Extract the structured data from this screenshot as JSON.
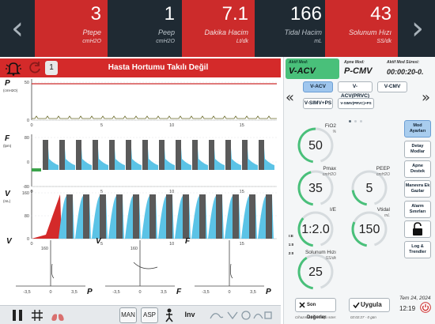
{
  "metrics": [
    {
      "value": "3",
      "label": "Ptepe",
      "unit": "cmH2O",
      "style": "red"
    },
    {
      "value": "1",
      "label": "Peep",
      "unit": "cmH2O",
      "style": "dark"
    },
    {
      "value": "7.1",
      "label": "Dakika Hacim",
      "unit": "Lt/dk",
      "style": "red"
    },
    {
      "value": "166",
      "label": "Tidal Hacim",
      "unit": "mL",
      "style": "dark"
    },
    {
      "value": "43",
      "label": "Solunum Hızı",
      "unit": "SS/dk",
      "style": "red"
    }
  ],
  "alarm": {
    "count": "1",
    "message": "Hasta Hortumu Takılı Değil"
  },
  "waves": [
    {
      "label": "P",
      "unit": "(cmH2O)",
      "yticks": [
        "50",
        "0"
      ],
      "xticks": [
        "0",
        "5",
        "10",
        "15"
      ]
    },
    {
      "label": "F",
      "unit": "(lpm)",
      "yticks": [
        "80",
        "0",
        "-80"
      ],
      "xticks": [
        "0",
        "5",
        "10",
        "15"
      ]
    },
    {
      "label": "V",
      "unit": "(mL)",
      "yticks": [
        "160",
        "80",
        "0"
      ],
      "xticks": [
        "0",
        "5",
        "10",
        "15"
      ]
    }
  ],
  "loops": [
    {
      "ylabel": "V",
      "xlabel": "P",
      "ytick": "160",
      "xticks": [
        "-3,5",
        "0",
        "3,5"
      ]
    },
    {
      "ylabel": "V",
      "xlabel": "F",
      "ytick": "160",
      "xticks": [
        "-3,5",
        "0",
        "3,5"
      ]
    },
    {
      "ylabel": "F",
      "xlabel": "P",
      "ytick": "",
      "xticks": [
        "-3,5",
        "0",
        "3,5"
      ]
    }
  ],
  "toolbar": {
    "man": "MAN",
    "asp": "ASP",
    "inv": "Inv"
  },
  "mode": {
    "active_title": "Aktif Mod:",
    "active_value": "V-ACV",
    "apne_title": "Apne Mod:",
    "apne_value": "P-CMV",
    "time_title": "Aktif Mod Süresi:",
    "time_value": "00:00:20-0."
  },
  "mode_buttons": [
    "V-ACV",
    "V-ACV(PRVC)",
    "V-CMV",
    "V-SIMV+PS",
    "V-SIMV(PRVC)+PS"
  ],
  "knobs": [
    {
      "label": "FiO2",
      "unit": "%",
      "value": "50",
      "level": 0.5
    },
    {
      "label": "Pmax",
      "unit": "cmH2O",
      "value": "35",
      "level": 0.45
    },
    {
      "label": "PEEP",
      "unit": "cmH2O",
      "value": "5",
      "level": 0.2
    },
    {
      "label": "I/E",
      "unit": "",
      "value": "1:2.0",
      "level": 0.35
    },
    {
      "label": "Vtidal",
      "unit": "mL",
      "value": "150",
      "level": 0.3
    },
    {
      "label": "Solunum Hızı",
      "unit": "SS/dk",
      "value": "25",
      "level": 0.4
    }
  ],
  "ie_labels": [
    "I:E",
    "1:0",
    "2:0"
  ],
  "side_buttons": [
    "Mod Ayarları",
    "Detay Modlar",
    "Apne Destek",
    "Manevra Ek Gazlar",
    "Alarm Sınırları",
    "",
    "Log & Trendler"
  ],
  "footer": {
    "last_values": "Son Değerler",
    "apply": "Uygula",
    "last_note": "Cihazın Açık Olduğu süre:",
    "mid_note": "02:02:27 - 0 gün",
    "date": "Tem 24, 2024",
    "time": "12:19"
  },
  "colors": {
    "alarm_red": "#d42a2a",
    "accent_green": "#49c07a",
    "flow_blue": "#5bc3e6",
    "bar_gray": "#5a5a5a"
  }
}
